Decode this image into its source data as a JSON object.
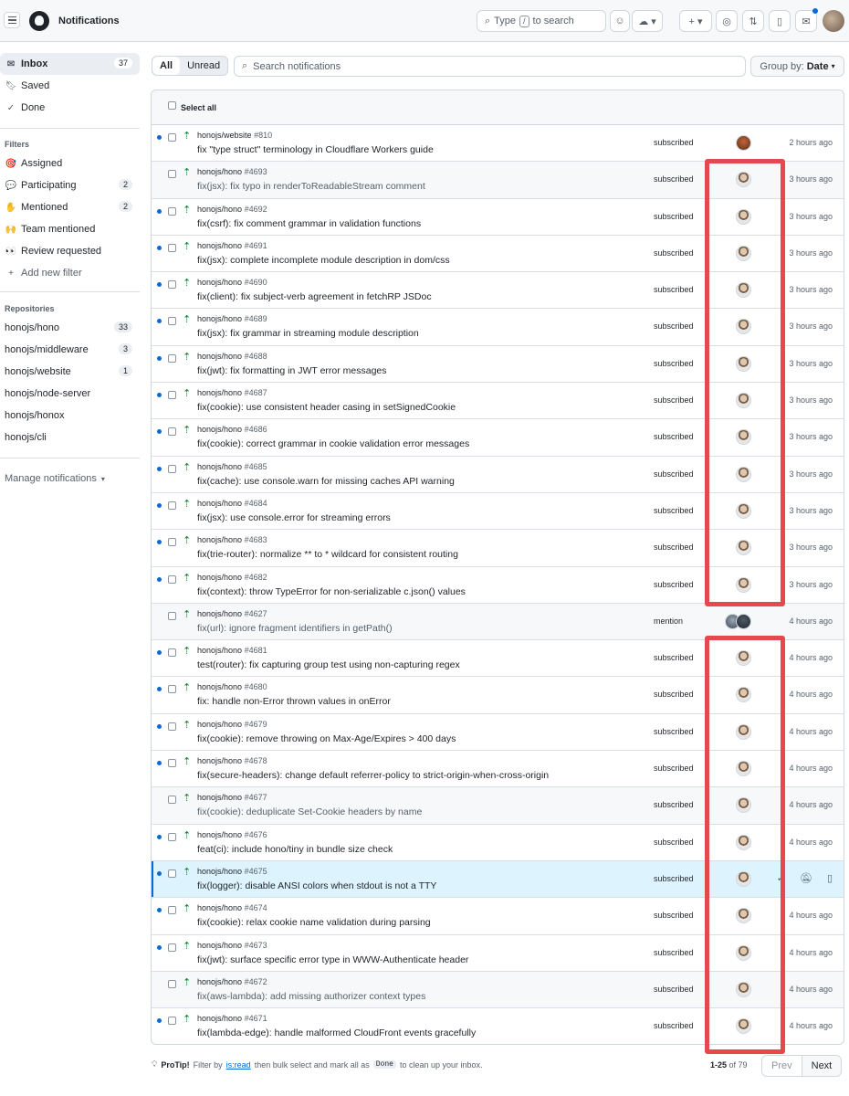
{
  "header": {
    "title": "Notifications",
    "search_placeholder_pre": "Type",
    "search_key": "/",
    "search_placeholder_post": "to search"
  },
  "sidebar": {
    "inbox": {
      "label": "Inbox",
      "count": "37"
    },
    "saved": {
      "label": "Saved"
    },
    "done": {
      "label": "Done"
    },
    "filters_heading": "Filters",
    "filters": [
      {
        "icon": "🎯",
        "label": "Assigned",
        "count": ""
      },
      {
        "icon": "💬",
        "label": "Participating",
        "count": "2"
      },
      {
        "icon": "✋",
        "label": "Mentioned",
        "count": "2"
      },
      {
        "icon": "🙌",
        "label": "Team mentioned",
        "count": ""
      },
      {
        "icon": "👀",
        "label": "Review requested",
        "count": ""
      }
    ],
    "add_filter": "Add new filter",
    "repos_heading": "Repositories",
    "repos": [
      {
        "label": "honojs/hono",
        "count": "33"
      },
      {
        "label": "honojs/middleware",
        "count": "3"
      },
      {
        "label": "honojs/website",
        "count": "1"
      },
      {
        "label": "honojs/node-server",
        "count": ""
      },
      {
        "label": "honojs/honox",
        "count": ""
      },
      {
        "label": "honojs/cli",
        "count": ""
      }
    ],
    "manage": "Manage notifications"
  },
  "toolbar": {
    "all": "All",
    "unread": "Unread",
    "search_placeholder": "Search notifications",
    "group_by_label": "Group by:",
    "group_by_value": "Date"
  },
  "list": {
    "select_all": "Select all",
    "rows": [
      {
        "repo": "honojs/website",
        "num": "#810",
        "title": "fix \"type struct\" terminology in Cloudflare Workers guide",
        "reason": "subscribed",
        "time": "2 hours ago",
        "unread": true
      },
      {
        "repo": "honojs/hono",
        "num": "#4693",
        "title": "fix(jsx): fix typo in renderToReadableStream comment",
        "reason": "subscribed",
        "time": "3 hours ago",
        "unread": false
      },
      {
        "repo": "honojs/hono",
        "num": "#4692",
        "title": "fix(csrf): fix comment grammar in validation functions",
        "reason": "subscribed",
        "time": "3 hours ago",
        "unread": true
      },
      {
        "repo": "honojs/hono",
        "num": "#4691",
        "title": "fix(jsx): complete incomplete module description in dom/css",
        "reason": "subscribed",
        "time": "3 hours ago",
        "unread": true
      },
      {
        "repo": "honojs/hono",
        "num": "#4690",
        "title": "fix(client): fix subject-verb agreement in fetchRP JSDoc",
        "reason": "subscribed",
        "time": "3 hours ago",
        "unread": true
      },
      {
        "repo": "honojs/hono",
        "num": "#4689",
        "title": "fix(jsx): fix grammar in streaming module description",
        "reason": "subscribed",
        "time": "3 hours ago",
        "unread": true
      },
      {
        "repo": "honojs/hono",
        "num": "#4688",
        "title": "fix(jwt): fix formatting in JWT error messages",
        "reason": "subscribed",
        "time": "3 hours ago",
        "unread": true
      },
      {
        "repo": "honojs/hono",
        "num": "#4687",
        "title": "fix(cookie): use consistent header casing in setSignedCookie",
        "reason": "subscribed",
        "time": "3 hours ago",
        "unread": true
      },
      {
        "repo": "honojs/hono",
        "num": "#4686",
        "title": "fix(cookie): correct grammar in cookie validation error messages",
        "reason": "subscribed",
        "time": "3 hours ago",
        "unread": true
      },
      {
        "repo": "honojs/hono",
        "num": "#4685",
        "title": "fix(cache): use console.warn for missing caches API warning",
        "reason": "subscribed",
        "time": "3 hours ago",
        "unread": true
      },
      {
        "repo": "honojs/hono",
        "num": "#4684",
        "title": "fix(jsx): use console.error for streaming errors",
        "reason": "subscribed",
        "time": "3 hours ago",
        "unread": true
      },
      {
        "repo": "honojs/hono",
        "num": "#4683",
        "title": "fix(trie-router): normalize ** to * wildcard for consistent routing",
        "reason": "subscribed",
        "time": "3 hours ago",
        "unread": true
      },
      {
        "repo": "honojs/hono",
        "num": "#4682",
        "title": "fix(context): throw TypeError for non-serializable c.json() values",
        "reason": "subscribed",
        "time": "3 hours ago",
        "unread": true
      },
      {
        "repo": "honojs/hono",
        "num": "#4627",
        "title": "fix(url): ignore fragment identifiers in getPath()",
        "reason": "mention",
        "time": "4 hours ago",
        "unread": false
      },
      {
        "repo": "honojs/hono",
        "num": "#4681",
        "title": "test(router): fix capturing group test using non-capturing regex",
        "reason": "subscribed",
        "time": "4 hours ago",
        "unread": true
      },
      {
        "repo": "honojs/hono",
        "num": "#4680",
        "title": "fix: handle non-Error thrown values in onError",
        "reason": "subscribed",
        "time": "4 hours ago",
        "unread": true
      },
      {
        "repo": "honojs/hono",
        "num": "#4679",
        "title": "fix(cookie): remove throwing on Max-Age/Expires > 400 days",
        "reason": "subscribed",
        "time": "4 hours ago",
        "unread": true
      },
      {
        "repo": "honojs/hono",
        "num": "#4678",
        "title": "fix(secure-headers): change default referrer-policy to strict-origin-when-cross-origin",
        "reason": "subscribed",
        "time": "4 hours ago",
        "unread": true
      },
      {
        "repo": "honojs/hono",
        "num": "#4677",
        "title": "fix(cookie): deduplicate Set-Cookie headers by name",
        "reason": "subscribed",
        "time": "4 hours ago",
        "unread": false
      },
      {
        "repo": "honojs/hono",
        "num": "#4676",
        "title": "feat(ci): include hono/tiny in bundle size check",
        "reason": "subscribed",
        "time": "4 hours ago",
        "unread": true
      },
      {
        "repo": "honojs/hono",
        "num": "#4675",
        "title": "fix(logger): disable ANSI colors when stdout is not a TTY",
        "reason": "subscribed",
        "time": "",
        "unread": true
      },
      {
        "repo": "honojs/hono",
        "num": "#4674",
        "title": "fix(cookie): relax cookie name validation during parsing",
        "reason": "subscribed",
        "time": "4 hours ago",
        "unread": true
      },
      {
        "repo": "honojs/hono",
        "num": "#4673",
        "title": "fix(jwt): surface specific error type in WWW-Authenticate header",
        "reason": "subscribed",
        "time": "4 hours ago",
        "unread": true
      },
      {
        "repo": "honojs/hono",
        "num": "#4672",
        "title": "fix(aws-lambda): add missing authorizer context types",
        "reason": "subscribed",
        "time": "4 hours ago",
        "unread": false
      },
      {
        "repo": "honojs/hono",
        "num": "#4671",
        "title": "fix(lambda-edge): handle malformed CloudFront events gracefully",
        "reason": "subscribed",
        "time": "4 hours ago",
        "unread": true
      }
    ]
  },
  "footer": {
    "protip_bold": "ProTip!",
    "protip_1": "Filter by",
    "protip_link": "is:read",
    "protip_2": "then bulk select and mark all as",
    "protip_code": "Done",
    "protip_3": "to clean up your inbox.",
    "range": "1-25",
    "of": "of 79",
    "prev": "Prev",
    "next": "Next"
  },
  "colors": {
    "accent": "#0969da",
    "annotation_red": "#e5484d",
    "pr_green": "#1a7f37"
  }
}
